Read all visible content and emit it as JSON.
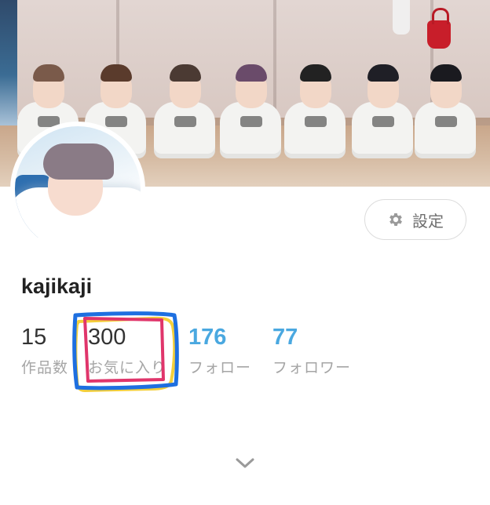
{
  "profile": {
    "username": "kajikaji",
    "settings_label": "設定"
  },
  "stats": [
    {
      "value": "15",
      "label": "作品数"
    },
    {
      "value": "300",
      "label": "お気に入り"
    },
    {
      "value": "176",
      "label": "フォロー"
    },
    {
      "value": "77",
      "label": "フォロワー"
    }
  ],
  "icons": {
    "settings": "gear-icon",
    "expand": "chevron-down-icon"
  },
  "colors": {
    "accent": "#4aa8e0",
    "muted_text": "#a5a5a5",
    "highlight_blue": "#1e6fe0",
    "highlight_pink": "#e0356b",
    "highlight_yellow": "#f4cf3a"
  }
}
